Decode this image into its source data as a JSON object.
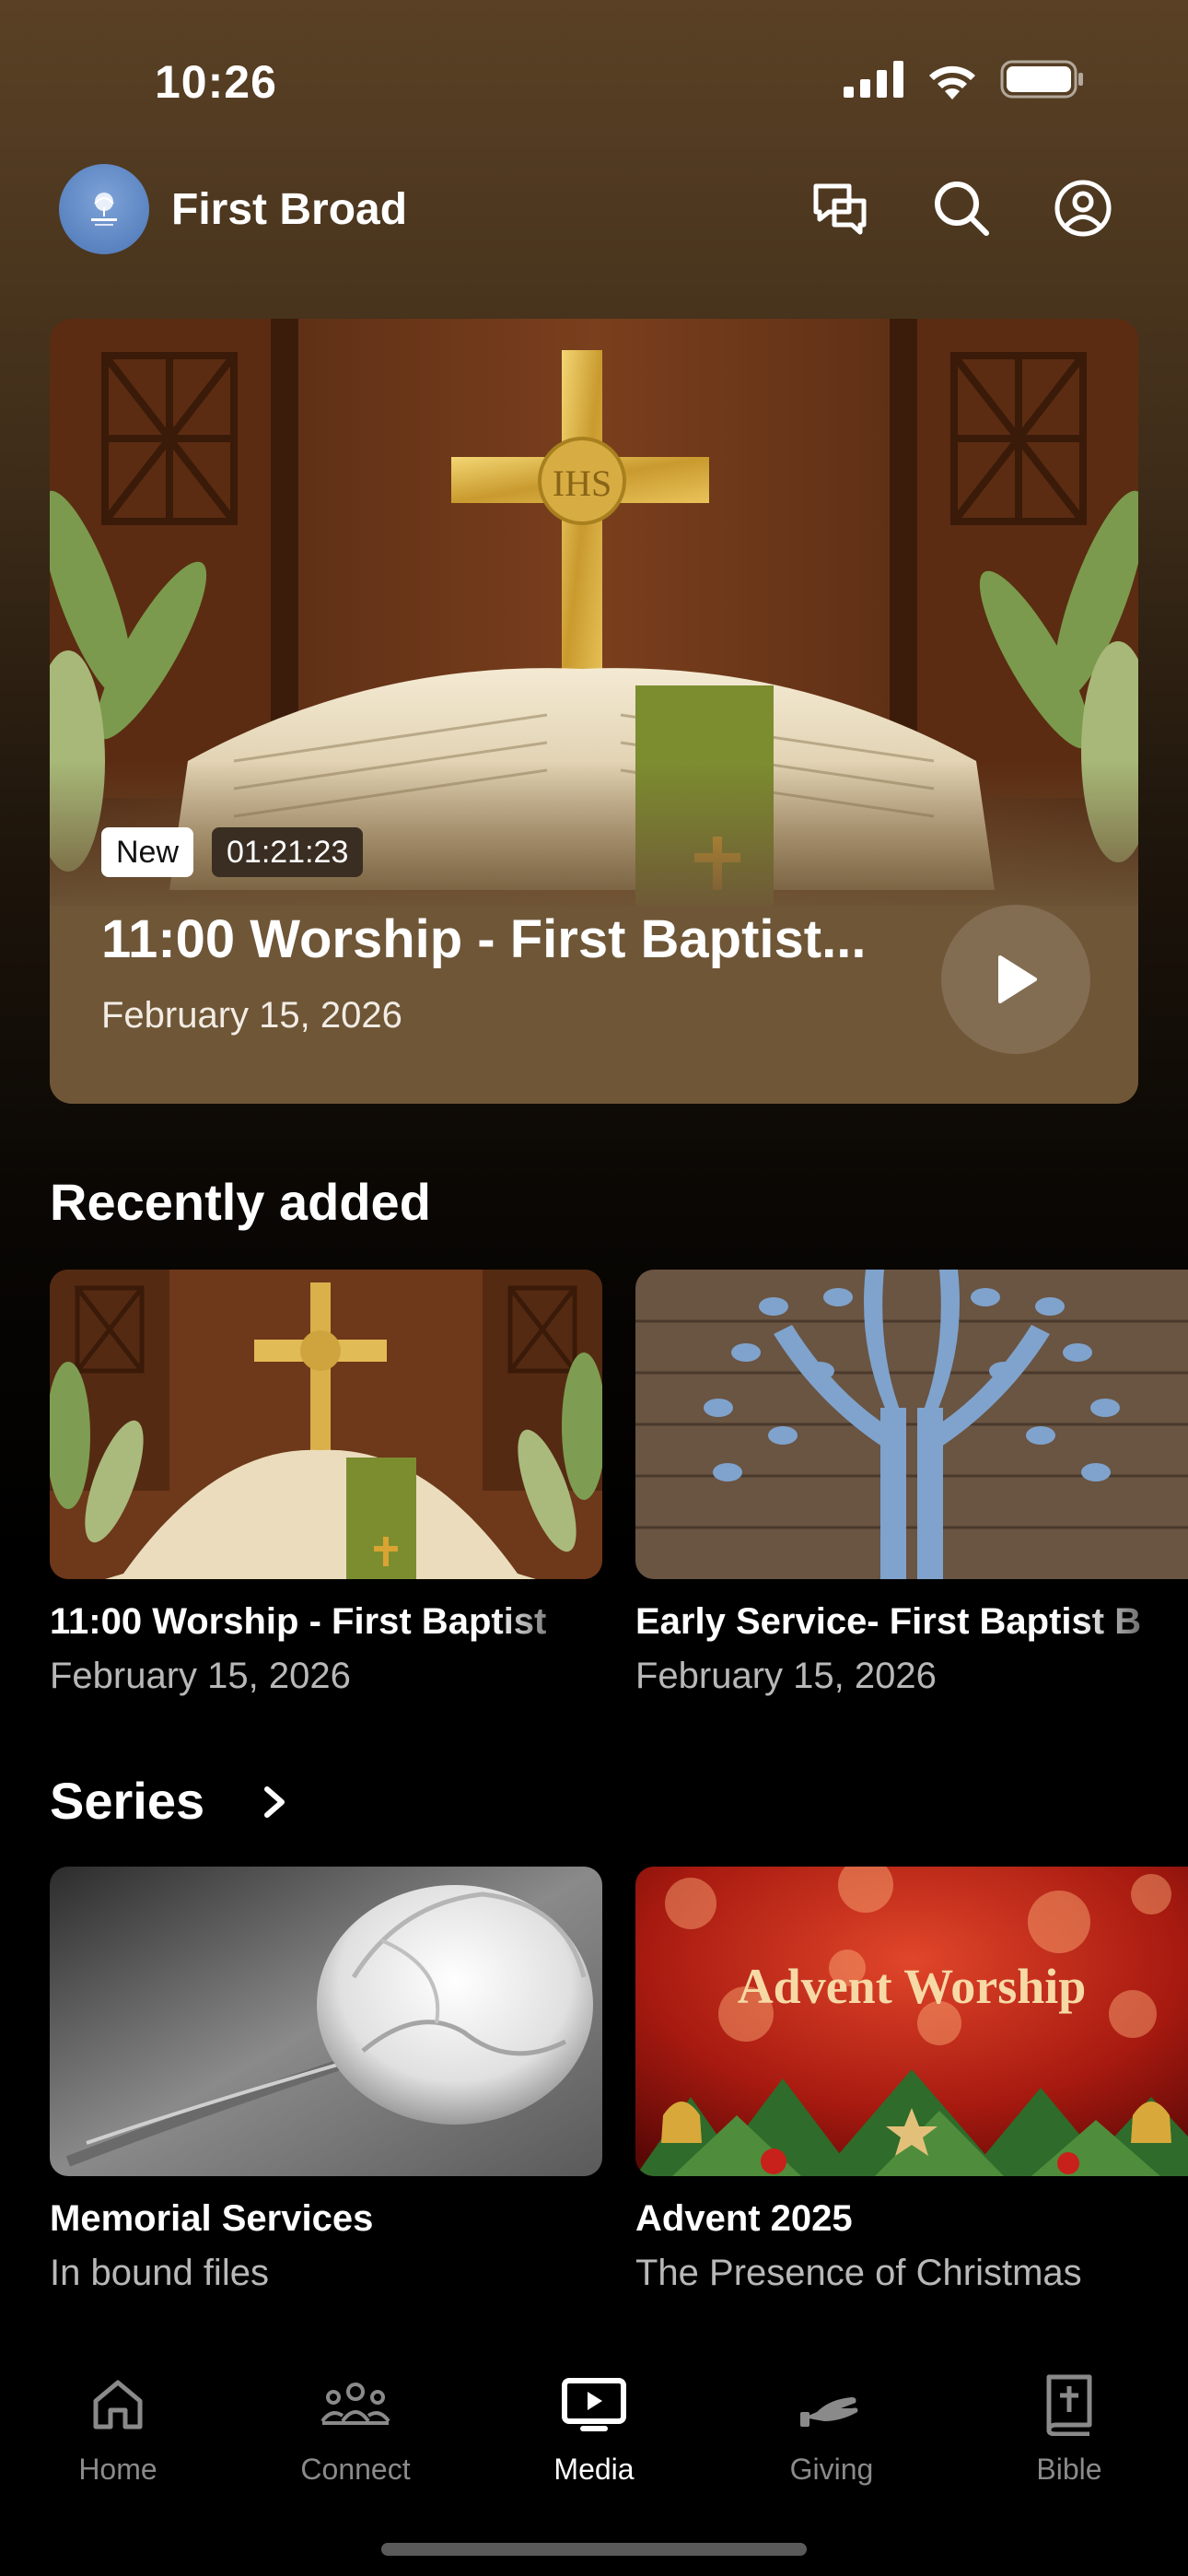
{
  "status_bar": {
    "time": "10:26"
  },
  "header": {
    "org_name": "First Broad",
    "icons": [
      "chat-icon",
      "search-icon",
      "profile-icon"
    ]
  },
  "hero": {
    "badge": "New",
    "duration": "01:21:23",
    "title": "11:00 Worship - First Baptist...",
    "date": "February 15, 2026"
  },
  "recently_added": {
    "title": "Recently added",
    "items": [
      {
        "title": "11:00 Worship - First Baptist",
        "date": "February 15, 2026"
      },
      {
        "title": "Early Service- First Baptist B",
        "date": "February 15, 2026"
      }
    ]
  },
  "series": {
    "title": "Series",
    "items": [
      {
        "title": "Memorial Services",
        "subtitle": "In bound files"
      },
      {
        "title": "Advent 2025",
        "subtitle": "The Presence of Christmas",
        "thumb_text": "Advent Worship"
      }
    ]
  },
  "tabbar": {
    "tabs": [
      {
        "label": "Home",
        "icon": "home-icon"
      },
      {
        "label": "Connect",
        "icon": "people-icon"
      },
      {
        "label": "Media",
        "icon": "media-icon",
        "active": true
      },
      {
        "label": "Giving",
        "icon": "giving-icon"
      },
      {
        "label": "Bible",
        "icon": "bible-icon"
      }
    ]
  },
  "colors": {
    "accent_brown": "#6e5637",
    "background": "#000000",
    "avatar_blue": "#5a83c0"
  }
}
